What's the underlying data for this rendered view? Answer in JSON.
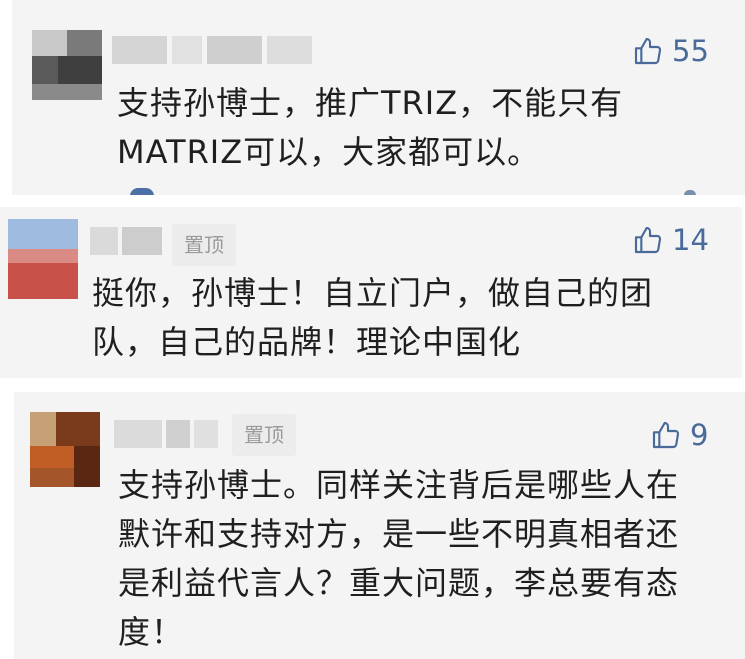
{
  "comments": [
    {
      "likes": "55",
      "lines": [
        "支持孙博士，推广TRIZ，不能只有",
        "MATRIZ可以，大家都可以。"
      ]
    },
    {
      "pinned_label": "置顶",
      "likes": "14",
      "lines": [
        "挺你，孙博士！自立门户，做自己的团",
        "队，自己的品牌！理论中国化"
      ]
    },
    {
      "pinned_label": "置顶",
      "likes": "9",
      "lines": [
        "支持孙博士。同样关注背后是哪些人在",
        "默许和支持对方，是一些不明真相者还",
        "是利益代言人？重大问题，李总要有态",
        "度！"
      ]
    }
  ],
  "icons": {
    "like": "thumbs-up-icon"
  },
  "colors": {
    "like": "#4a6a9a",
    "text": "#1f1f1f",
    "card": "#f4f4f4",
    "pin_text": "#9a9a9a"
  }
}
